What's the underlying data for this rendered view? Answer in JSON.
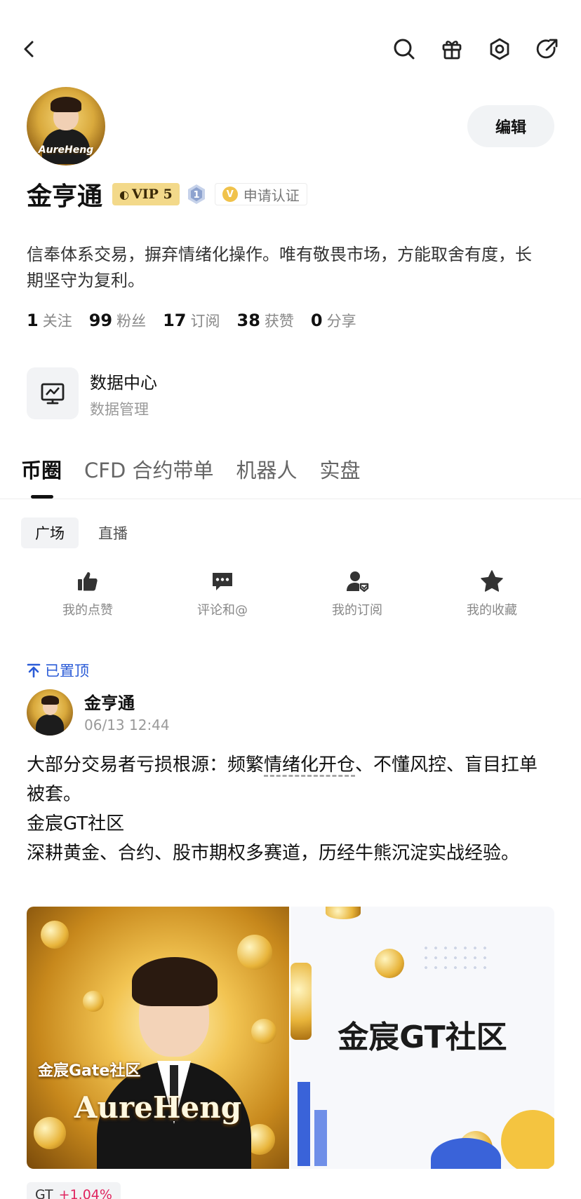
{
  "header": {
    "icons": [
      "back-icon",
      "search-icon",
      "gift-icon",
      "settings-icon",
      "share-icon"
    ]
  },
  "profile": {
    "avatar_text": "AureHeng",
    "name": "金亨通",
    "vip_label": "VIP 5",
    "level_badge": "1",
    "verify_label": "申请认证",
    "verify_mark": "V",
    "edit_label": "编辑",
    "bio": "信奉体系交易，摒弃情绪化操作。唯有敬畏市场，方能取舍有度，长期坚守为复利。"
  },
  "stats": [
    {
      "count": "1",
      "label": "关注"
    },
    {
      "count": "99",
      "label": "粉丝"
    },
    {
      "count": "17",
      "label": "订阅"
    },
    {
      "count": "38",
      "label": "获赞"
    },
    {
      "count": "0",
      "label": "分享"
    }
  ],
  "data_center": {
    "title": "数据中心",
    "subtitle": "数据管理"
  },
  "tabs": [
    "币圈",
    "CFD 合约带单",
    "机器人",
    "实盘"
  ],
  "active_tab": "币圈",
  "subtabs": [
    "广场",
    "直播"
  ],
  "quick_actions": [
    {
      "label": "我的点赞",
      "icon": "thumbs-up-icon"
    },
    {
      "label": "评论和@",
      "icon": "comment-icon"
    },
    {
      "label": "我的订阅",
      "icon": "subscribe-icon"
    },
    {
      "label": "我的收藏",
      "icon": "star-icon"
    }
  ],
  "post": {
    "pinned_label": "已置顶",
    "author": "金亨通",
    "time": "06/13 12:44",
    "line1_a": "大部分交易者亏损根源：频繁",
    "line1_u": "情绪化开仓",
    "line1_b": "、不懂风控、盲目扛单被套。",
    "line2": "金宸GT社区",
    "line3": "深耕黄金、合约、股市期权多赛道，历经牛熊沉淀实战经验。",
    "image1_text1": "金宸Gate社区",
    "image1_text2": "AureHeng",
    "image2_title": "金宸GT社区",
    "tag_symbol": "GT",
    "tag_change": "+1.04%"
  },
  "colors": {
    "accent_blue": "#2a5bd7",
    "vip_gold": "#f3d98a",
    "up_red": "#e0245e"
  }
}
